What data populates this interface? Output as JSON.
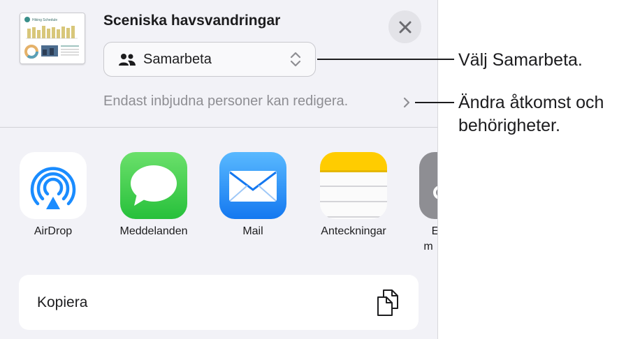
{
  "share_sheet": {
    "document_title": "Sceniska havsvandringar",
    "thumbnail_heading": "Hiking Schedule",
    "collaboration_mode": "Samarbeta",
    "access_text": "Endast inbjudna personer kan redigera.",
    "apps": [
      {
        "label": "AirDrop",
        "icon": "airdrop-icon"
      },
      {
        "label": "Meddelanden",
        "icon": "messages-icon"
      },
      {
        "label": "Mail",
        "icon": "mail-icon"
      },
      {
        "label": "Anteckningar",
        "icon": "notes-icon"
      },
      {
        "label_line1": "E",
        "label_line2": "m",
        "icon": "more-app-icon"
      }
    ],
    "copy_action": "Kopiera"
  },
  "callouts": {
    "collaborate": "Välj Samarbeta.",
    "access_line1": "Ändra åtkomst och",
    "access_line2": "behörigheter."
  },
  "colors": {
    "sheet_background": "#f2f2f7",
    "airdrop_blue": "#1a8cff",
    "messages_green": "#27c03b",
    "mail_blue": "#1478f0",
    "notes_yellow": "#ffcc00"
  }
}
